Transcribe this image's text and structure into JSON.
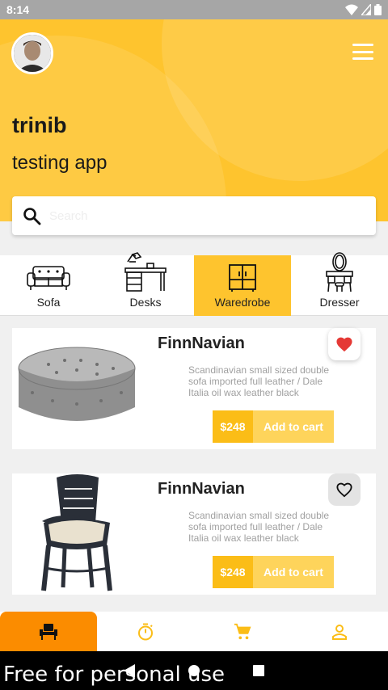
{
  "status": {
    "time": "8:14"
  },
  "header": {
    "username": "trinib",
    "subtitle": "testing app"
  },
  "search": {
    "placeholder": "Search"
  },
  "categories": [
    {
      "label": "Sofa",
      "icon": "sofa-icon"
    },
    {
      "label": "Desks",
      "icon": "desk-icon"
    },
    {
      "label": "Waredrobe",
      "icon": "wardrobe-icon",
      "active": true
    },
    {
      "label": "Dresser",
      "icon": "dresser-icon"
    }
  ],
  "products": [
    {
      "title": "FinnNavian",
      "desc": "Scandinavian small sized double sofa imported full leather / Dale Italia oil wax leather black",
      "price": "$248",
      "cart_label": "Add to cart",
      "favorite": true,
      "image": "ottoman-image"
    },
    {
      "title": "FinnNavian",
      "desc": "Scandinavian small sized double sofa imported full leather / Dale Italia oil wax leather black",
      "price": "$248",
      "cart_label": "Add to cart",
      "favorite": false,
      "image": "chair-image"
    }
  ],
  "bottom_nav": [
    {
      "icon": "chair-icon",
      "active": true
    },
    {
      "icon": "timer-icon"
    },
    {
      "icon": "cart-icon"
    },
    {
      "icon": "person-icon"
    }
  ],
  "watermark": "Free for personal use",
  "colors": {
    "accent": "#fec42e",
    "active_nav": "#fb8c00",
    "price_bg": "#fbbd17",
    "cart_bg": "#fed45b"
  }
}
